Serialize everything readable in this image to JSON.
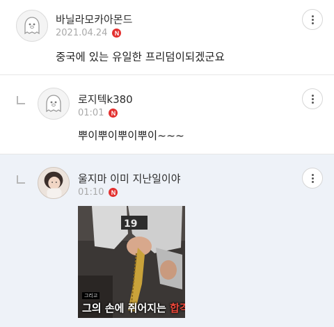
{
  "comments": [
    {
      "nickname": "바닐라모카아몬드",
      "date": "2021.04.24",
      "badge": "N",
      "text": "중국에 있는 유일한 프리덤이되겠군요",
      "avatar": "ghost-icon"
    },
    {
      "nickname": "로지텍k380",
      "date": "01:01",
      "badge": "N",
      "text": "뿌이뿌이뿌이뿌이~~~",
      "avatar": "ghost-icon"
    },
    {
      "nickname": "울지마 이미 지난일이야",
      "date": "01:10",
      "badge": "N",
      "avatar": "profile-photo",
      "media": {
        "tag": "그리고",
        "caption_main": "그의 손에 쥐어지는 ",
        "caption_highlight": "합격 목"
      }
    }
  ],
  "colors": {
    "badge": "#e3302f",
    "reply_bg": "#eef2f8",
    "meta_text": "#a9a9a9",
    "caption_highlight": "#e9473a"
  }
}
